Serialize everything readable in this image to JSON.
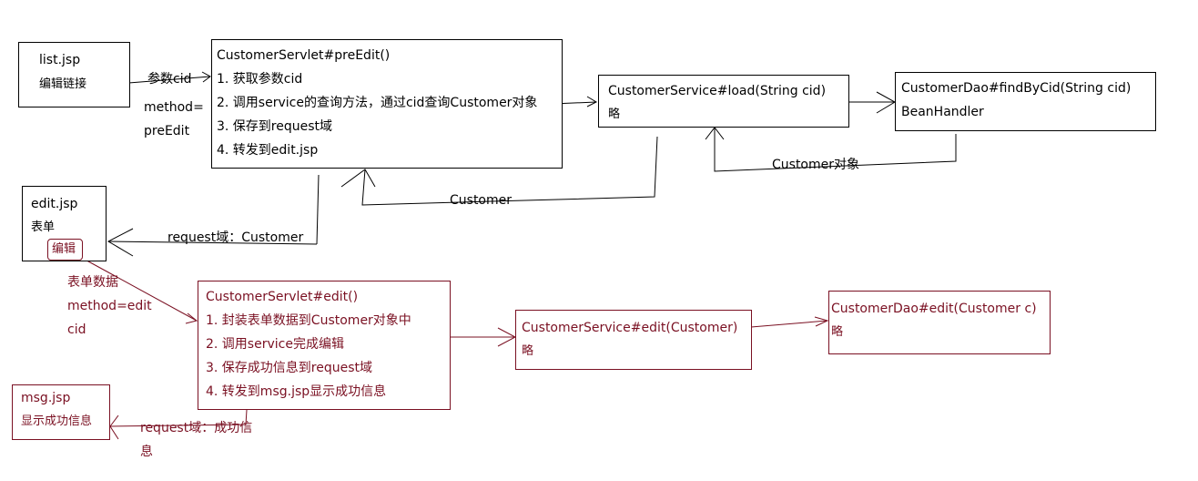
{
  "list_box": {
    "title": "list.jsp",
    "link": "编辑链接"
  },
  "label_param": "参数cid",
  "label_method_1": "method=",
  "label_method_2": "preEdit",
  "preedit_servlet": {
    "title": "CustomerServlet#preEdit()",
    "steps": [
      "1. 获取参数cid",
      "2. 调用service的查询方法，通过cid查询Customer对象",
      "3. 保存到request域",
      "4. 转发到edit.jsp"
    ]
  },
  "load_service": {
    "title": "CustomerService#load(String cid)",
    "note": "略"
  },
  "find_dao": {
    "title": "CustomerDao#findByCid(String cid)",
    "note": "BeanHandler"
  },
  "label_customer_obj": "Customer对象",
  "label_customer": "Customer",
  "edit_box": {
    "title": "edit.jsp",
    "form": "表单",
    "button": "编辑"
  },
  "label_request_customer": "request域：Customer",
  "label_form_data": "表单数据",
  "label_method_edit": "method=edit",
  "label_cid": "cid",
  "edit_servlet": {
    "title": "CustomerServlet#edit()",
    "steps": [
      "1. 封装表单数据到Customer对象中",
      "2. 调用service完成编辑",
      "3. 保存成功信息到request域",
      "4. 转发到msg.jsp显示成功信息"
    ]
  },
  "edit_service": {
    "title": "CustomerService#edit(Customer)",
    "note": "略"
  },
  "edit_dao": {
    "title": "CustomerDao#edit(Customer c)",
    "note": "略"
  },
  "msg_box": {
    "title": "msg.jsp",
    "text": "显示成功信息"
  },
  "label_request_success_1": "request域：成功信",
  "label_request_success_2": "息",
  "colors": {
    "black": "#000000",
    "dark_red": "#7a1022"
  }
}
